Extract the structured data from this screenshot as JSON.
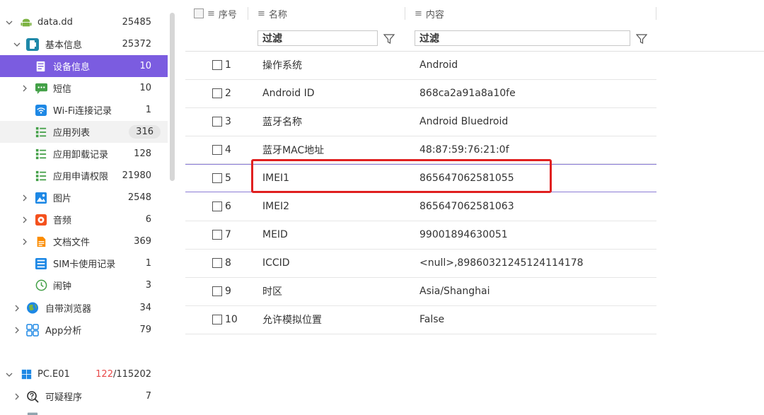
{
  "sidebar": {
    "device": {
      "label": "data.dd",
      "count": "25485"
    },
    "basic": {
      "label": "基本信息",
      "count": "25372"
    },
    "items": [
      {
        "label": "设备信息",
        "count": "10"
      },
      {
        "label": "短信",
        "count": "10"
      },
      {
        "label": "Wi-Fi连接记录",
        "count": "1"
      },
      {
        "label": "应用列表",
        "count": "316"
      },
      {
        "label": "应用卸载记录",
        "count": "128"
      },
      {
        "label": "应用申请权限",
        "count": "21980"
      },
      {
        "label": "图片",
        "count": "2548"
      },
      {
        "label": "音频",
        "count": "6"
      },
      {
        "label": "文档文件",
        "count": "369"
      },
      {
        "label": "SIM卡使用记录",
        "count": "1"
      },
      {
        "label": "闹钟",
        "count": "3"
      }
    ],
    "browser": {
      "label": "自带浏览器",
      "count": "34"
    },
    "app_analysis": {
      "label": "App分析",
      "count": "79"
    },
    "pc": {
      "label": "PC.E01",
      "count_part": "122",
      "count_total": "/115202"
    },
    "suspicious": {
      "label": "可疑程序",
      "count": "7"
    },
    "colors": {
      "selected_bg": "#7b5ce0",
      "android_green": "#7cb342"
    }
  },
  "table": {
    "headers": {
      "seq": "序号",
      "name": "名称",
      "content": "内容"
    },
    "filter_placeholder": "过滤",
    "rows": [
      {
        "seq": "1",
        "name": "操作系统",
        "value": "Android"
      },
      {
        "seq": "2",
        "name": "Android ID",
        "value": "868ca2a91a8a10fe"
      },
      {
        "seq": "3",
        "name": "蓝牙名称",
        "value": "Android Bluedroid"
      },
      {
        "seq": "4",
        "name": "蓝牙MAC地址",
        "value": "48:87:59:76:21:0f"
      },
      {
        "seq": "5",
        "name": "IMEI1",
        "value": "865647062581055"
      },
      {
        "seq": "6",
        "name": "IMEI2",
        "value": "865647062581063"
      },
      {
        "seq": "7",
        "name": "MEID",
        "value": "99001894630051"
      },
      {
        "seq": "8",
        "name": "ICCID",
        "value": "<null>,89860321245124114178"
      },
      {
        "seq": "9",
        "name": "时区",
        "value": "Asia/Shanghai"
      },
      {
        "seq": "10",
        "name": "允许模拟位置",
        "value": "False"
      }
    ],
    "highlight_color": "#e02020"
  }
}
